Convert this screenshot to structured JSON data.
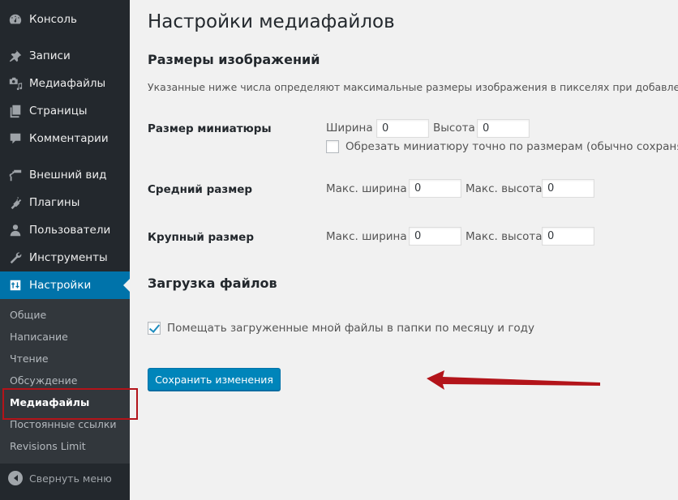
{
  "sidebar": {
    "items": [
      {
        "label": "Консоль",
        "icon": "dashboard-icon"
      },
      {
        "label": "Записи",
        "icon": "pin-icon"
      },
      {
        "label": "Медиафайлы",
        "icon": "media-icon"
      },
      {
        "label": "Страницы",
        "icon": "pages-icon"
      },
      {
        "label": "Комментарии",
        "icon": "comment-icon"
      },
      {
        "label": "Внешний вид",
        "icon": "paintbrush-icon"
      },
      {
        "label": "Плагины",
        "icon": "plugin-icon"
      },
      {
        "label": "Пользователи",
        "icon": "user-icon"
      },
      {
        "label": "Инструменты",
        "icon": "wrench-icon"
      },
      {
        "label": "Настройки",
        "icon": "settings-sliders-icon",
        "active": true
      }
    ],
    "submenu": [
      {
        "label": "Общие"
      },
      {
        "label": "Написание"
      },
      {
        "label": "Чтение"
      },
      {
        "label": "Обсуждение"
      },
      {
        "label": "Медиафайлы",
        "current": true
      },
      {
        "label": "Постоянные ссылки"
      },
      {
        "label": "Revisions Limit"
      }
    ],
    "collapse_label": "Свернуть меню"
  },
  "main": {
    "title": "Настройки медиафайлов",
    "image_sizes": {
      "heading": "Размеры изображений",
      "description": "Указанные ниже числа определяют максимальные размеры изображения в пикселях при добавлении",
      "thumbnail": {
        "label": "Размер миниатюры",
        "width_label": "Ширина",
        "width_value": "0",
        "height_label": "Высота",
        "height_value": "0",
        "crop_label": "Обрезать миниатюру точно по размерам (обычно сохраняю",
        "crop_checked": false
      },
      "medium": {
        "label": "Средний размер",
        "width_label": "Макс. ширина",
        "width_value": "0",
        "height_label": "Макс. высота",
        "height_value": "0"
      },
      "large": {
        "label": "Крупный размер",
        "width_label": "Макс. ширина",
        "width_value": "0",
        "height_label": "Макс. высота",
        "height_value": "0"
      }
    },
    "uploads": {
      "heading": "Загрузка файлов",
      "organize_label": "Помещать загруженные мной файлы в папки по месяцу и году",
      "organize_checked": true
    },
    "save_label": "Сохранить изменения"
  },
  "colors": {
    "sidebar_bg": "#23282d",
    "submenu_bg": "#32373c",
    "accent": "#0073aa",
    "button": "#0085ba",
    "annotation": "#b3141a"
  }
}
